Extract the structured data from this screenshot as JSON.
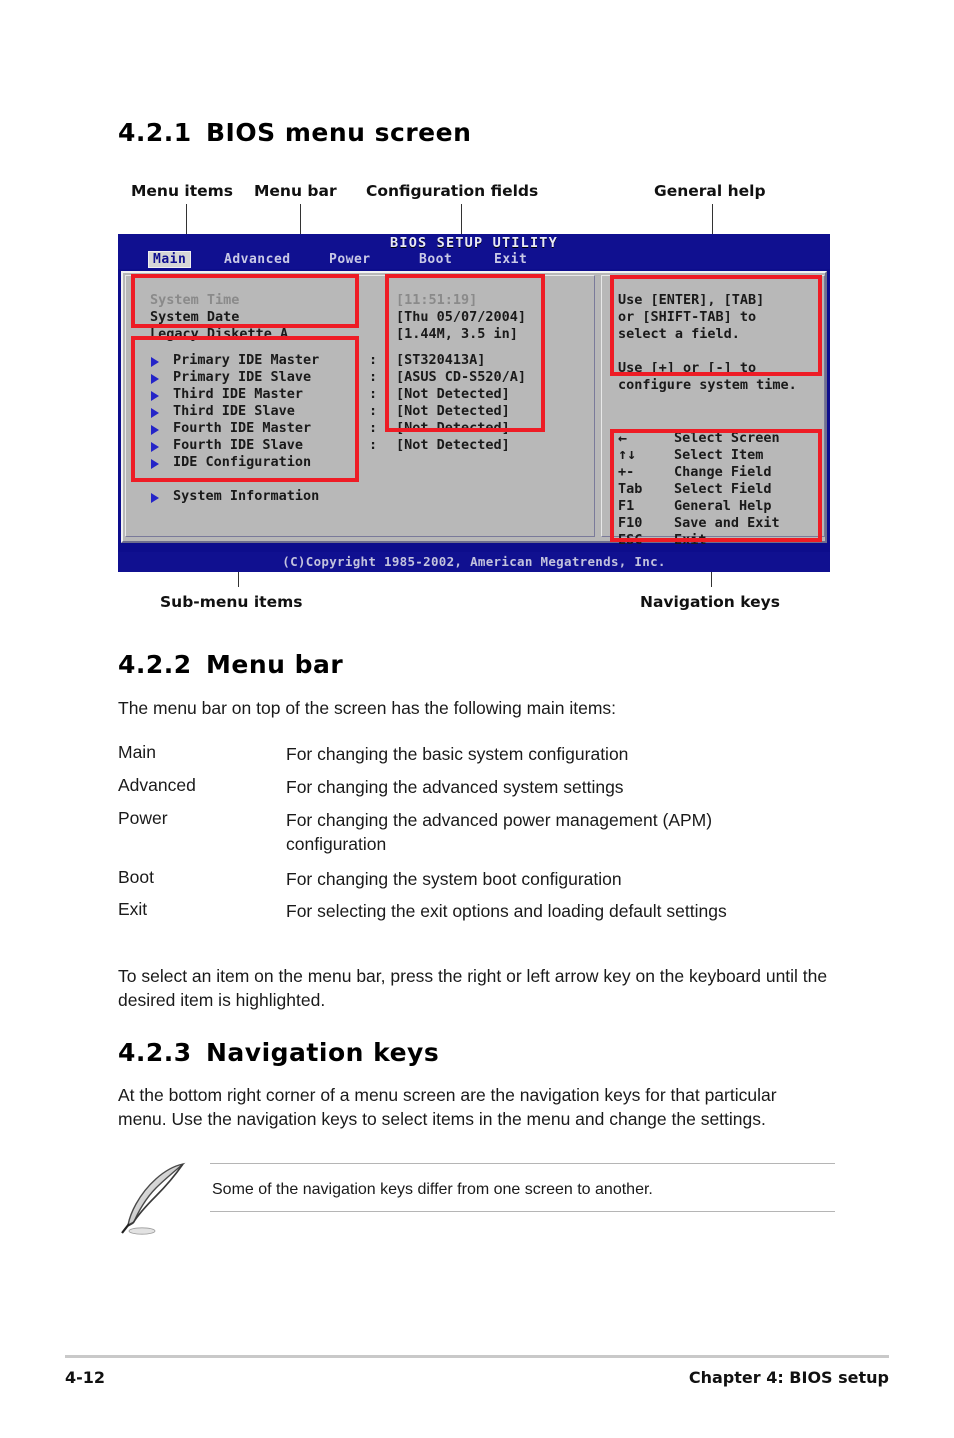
{
  "sections": {
    "s421": {
      "num": "4.2.1",
      "title": "BIOS menu screen"
    },
    "s422": {
      "num": "4.2.2",
      "title": "Menu bar"
    },
    "s423": {
      "num": "4.2.3",
      "title": "Navigation keys"
    }
  },
  "callouts": {
    "menu_items": "Menu items",
    "menu_bar": "Menu bar",
    "configuration_fields": "Configuration fields",
    "general_help": "General help",
    "sub_menu_items": "Sub-menu items",
    "navigation_keys": "Navigation keys"
  },
  "bios": {
    "title": "BIOS SETUP UTILITY",
    "menu": [
      {
        "label": "Main",
        "active": true
      },
      {
        "label": "Advanced",
        "active": false
      },
      {
        "label": "Power",
        "active": false
      },
      {
        "label": "Boot",
        "active": false
      },
      {
        "label": "Exit",
        "active": false
      }
    ],
    "main_items": [
      {
        "label": "System Time",
        "value": "[11:51:19]",
        "dim": true,
        "submenu": false
      },
      {
        "label": "System Date",
        "value": "[Thu 05/07/2004]",
        "dim": false,
        "submenu": false
      },
      {
        "label": "Legacy Diskette A",
        "value": "[1.44M, 3.5 in]",
        "dim": false,
        "submenu": false
      }
    ],
    "submenu_items": [
      {
        "label": "Primary IDE Master",
        "colon": ":",
        "value": "[ST320413A]"
      },
      {
        "label": "Primary IDE Slave",
        "colon": ":",
        "value": "[ASUS CD-S520/A]"
      },
      {
        "label": "Third IDE Master",
        "colon": ":",
        "value": "[Not Detected]"
      },
      {
        "label": "Third IDE Slave",
        "colon": ":",
        "value": "[Not Detected]"
      },
      {
        "label": "Fourth IDE Master",
        "colon": ":",
        "value": "[Not Detected]"
      },
      {
        "label": "Fourth IDE Slave",
        "colon": ":",
        "value": "[Not Detected]"
      },
      {
        "label": "IDE Configuration",
        "colon": "",
        "value": ""
      }
    ],
    "system_information": {
      "label": "System Information"
    },
    "help_lines": [
      "Use [ENTER], [TAB]",
      "or [SHIFT-TAB] to",
      "select a field.",
      "",
      "Use [+] or [-] to",
      "configure system time."
    ],
    "nav_keys": [
      {
        "key": "←",
        "desc": "Select Screen"
      },
      {
        "key": "↑↓",
        "desc": "Select Item"
      },
      {
        "key": "+-",
        "desc": "Change Field"
      },
      {
        "key": "Tab",
        "desc": "Select Field"
      },
      {
        "key": "F1",
        "desc": "General Help"
      },
      {
        "key": "F10",
        "desc": "Save and Exit"
      },
      {
        "key": "ESC",
        "desc": "Exit"
      }
    ],
    "copyright": "(C)Copyright 1985-2002, American Megatrends, Inc."
  },
  "menubar_section": {
    "intro": "The menu bar on top of the screen has the following main items:",
    "rows": [
      {
        "term": "Main",
        "desc": "For changing the basic system configuration"
      },
      {
        "term": "Advanced",
        "desc": "For changing the advanced system settings"
      },
      {
        "term": "Power",
        "desc": "For changing the advanced power management (APM) configuration"
      },
      {
        "term": "Boot",
        "desc": "For changing the system boot configuration"
      },
      {
        "term": "Exit",
        "desc": "For selecting the exit options and loading default settings"
      }
    ],
    "outro": "To select an item on the menu bar, press the right or left arrow key on the keyboard until the desired item is highlighted."
  },
  "navkeys_section": {
    "paragraph": "At the bottom right corner of a menu screen are the navigation keys for that particular menu. Use the navigation keys to select items in the menu and change the settings.",
    "note": "Some of the navigation keys differ from one screen to another."
  },
  "footer": {
    "page": "4-12",
    "chapter": "Chapter 4: BIOS setup"
  },
  "colors": {
    "annotation_red": "#ee1c25",
    "bios_blue": "#101090",
    "bios_grey": "#b8b8b8",
    "submenu_arrow": "#2424c8"
  }
}
